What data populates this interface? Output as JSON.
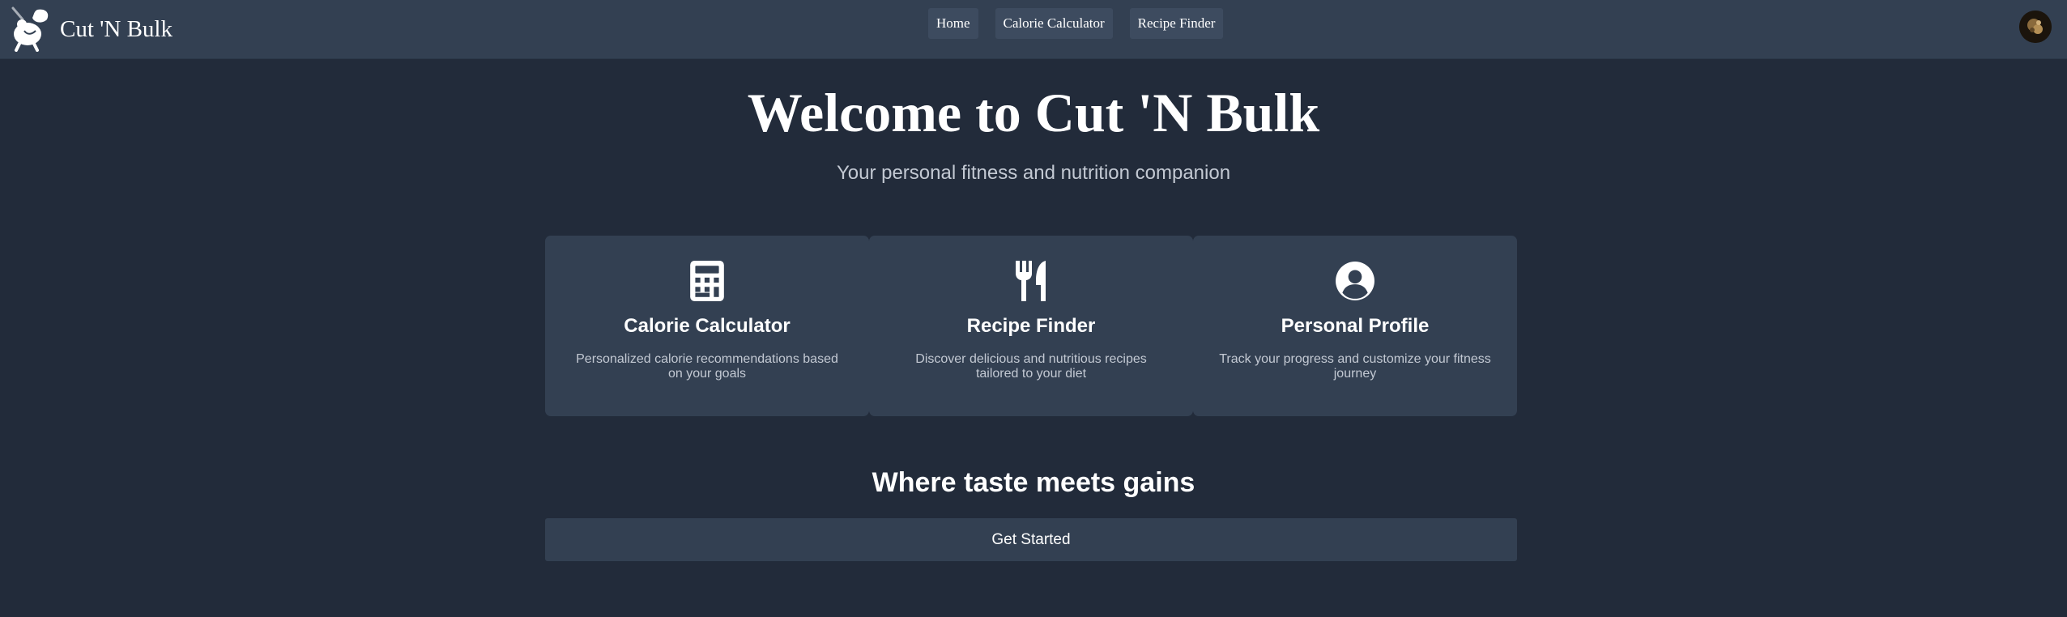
{
  "nav": {
    "brand_name": "Cut 'N Bulk",
    "links": [
      {
        "label": "Home"
      },
      {
        "label": "Calorie Calculator"
      },
      {
        "label": "Recipe Finder"
      }
    ]
  },
  "hero": {
    "title": "Welcome to Cut 'N Bulk",
    "subtitle": "Your personal fitness and nutrition companion"
  },
  "cards": [
    {
      "icon": "calculator-icon",
      "title": "Calorie Calculator",
      "description": "Personalized calorie recommendations based on your goals"
    },
    {
      "icon": "utensils-icon",
      "title": "Recipe Finder",
      "description": "Discover delicious and nutritious recipes tailored to your diet"
    },
    {
      "icon": "user-circle-icon",
      "title": "Personal Profile",
      "description": "Track your progress and customize your fitness journey"
    }
  ],
  "tagline": "Where taste meets gains",
  "cta_label": "Get Started",
  "colors": {
    "background": "#222b3a",
    "surface": "#334052",
    "text": "#ffffff",
    "muted_text": "#c3c9d3"
  }
}
